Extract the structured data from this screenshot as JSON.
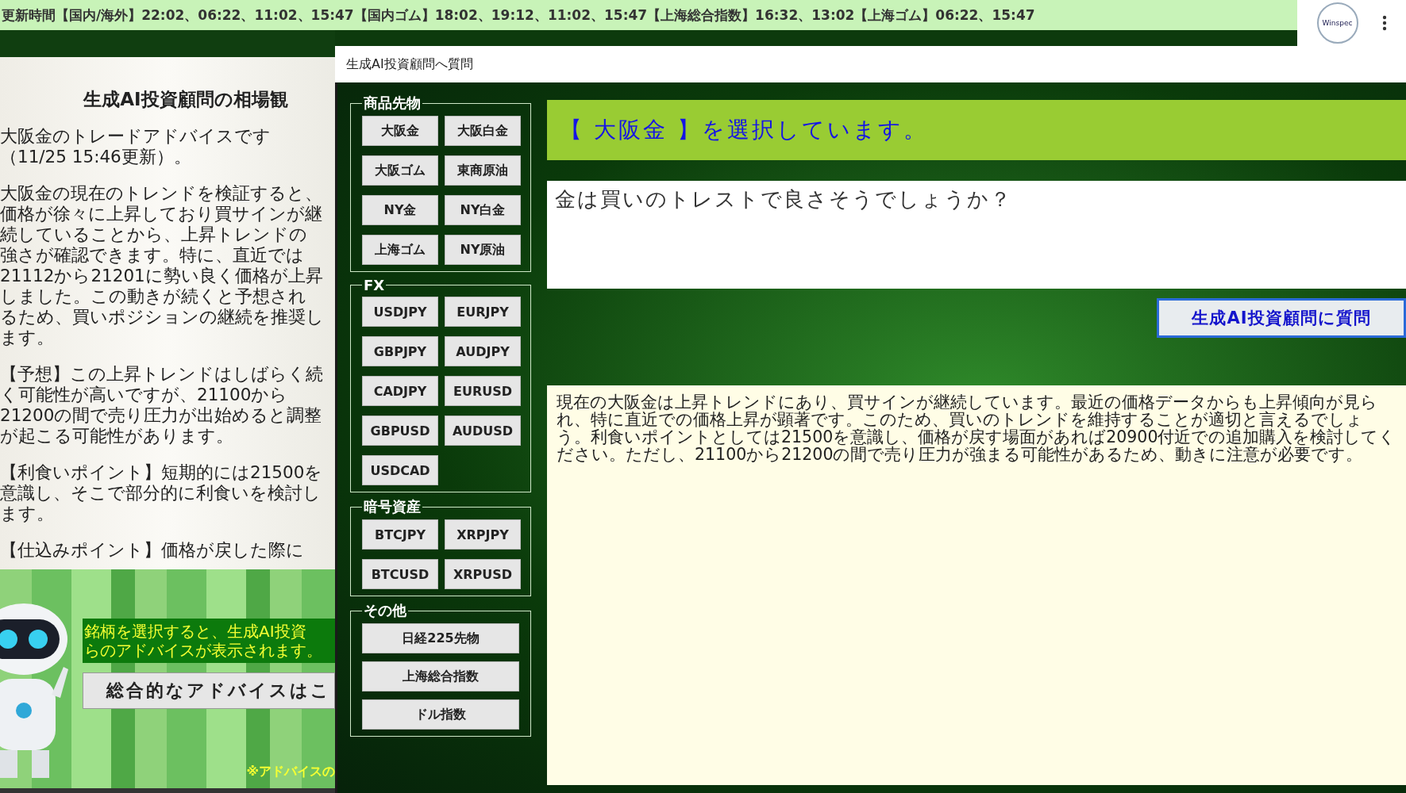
{
  "top_bar": {
    "text": "更新時間【国内/海外】22:02、06:22、11:02、15:47【国内ゴム】18:02、19:12、11:02、15:47【上海総合指数】16:32、13:02【上海ゴム】06:22、15:47",
    "logo_text": "Winspec"
  },
  "left_panel": {
    "title": "生成AI投資顧問の相場観",
    "paragraphs": [
      "大阪金のトレードアドバイスです（11/25 15:46更新）。",
      "大阪金の現在のトレンドを検証すると、価格が徐々に上昇しており買サインが継続していることから、上昇トレンドの強さが確認できます。特に、直近では21112から21201に勢い良く価格が上昇しました。この動きが続くと予想されるため、買いポジションの継続を推奨します。",
      "【予想】この上昇トレンドはしばらく続く可能性が高いですが、21100から21200の間で売り圧力が出始めると調整が起こる可能性があります。",
      "【利食いポイント】短期的には21500を意識し、そこで部分的に利食いを検討します。",
      "【仕込みポイント】価格が戻した際に"
    ],
    "promo_lines": [
      "銘柄を選択すると、生成AI投資",
      "らのアドバイスが表示されます。"
    ],
    "overall_button": "総合的なアドバイスはこ",
    "note": "※アドバイスの"
  },
  "dialog": {
    "title": "生成AI投資顧問へ質問",
    "groups": [
      {
        "label": "商品先物",
        "buttons": [
          "大阪金",
          "大阪白金",
          "大阪ゴム",
          "東商原油",
          "NY金",
          "NY白金",
          "上海ゴム",
          "NY原油"
        ],
        "kind": "pair"
      },
      {
        "label": "FX",
        "buttons": [
          "USDJPY",
          "EURJPY",
          "GBPJPY",
          "AUDJPY",
          "CADJPY",
          "EURUSD",
          "GBPUSD",
          "AUDUSD",
          "USDCAD"
        ],
        "kind": "pair"
      },
      {
        "label": "暗号資産",
        "buttons": [
          "BTCJPY",
          "XRPJPY",
          "BTCUSD",
          "XRPUSD"
        ],
        "kind": "pair"
      },
      {
        "label": "その他",
        "buttons": [
          "日経225先物",
          "上海総合指数",
          "ドル指数"
        ],
        "kind": "wide"
      }
    ],
    "selection_banner": "【 大阪金 】を選択しています。",
    "question": "金は買いのトレストで良さそうでしょうか？",
    "ask_button": "生成AI投資顧問に質問",
    "answer": "現在の大阪金は上昇トレンドにあり、買サインが継続しています。最近の価格データからも上昇傾向が見られ、特に直近での価格上昇が顕著です。このため、買いのトレンドを維持することが適切と言えるでしょう。利食いポイントとしては21500を意識し、価格が戻す場面があれば20900付近での追加購入を検討してください。ただし、21100から21200の間で売り圧力が強まる可能性があるため、動きに注意が必要です。"
  }
}
